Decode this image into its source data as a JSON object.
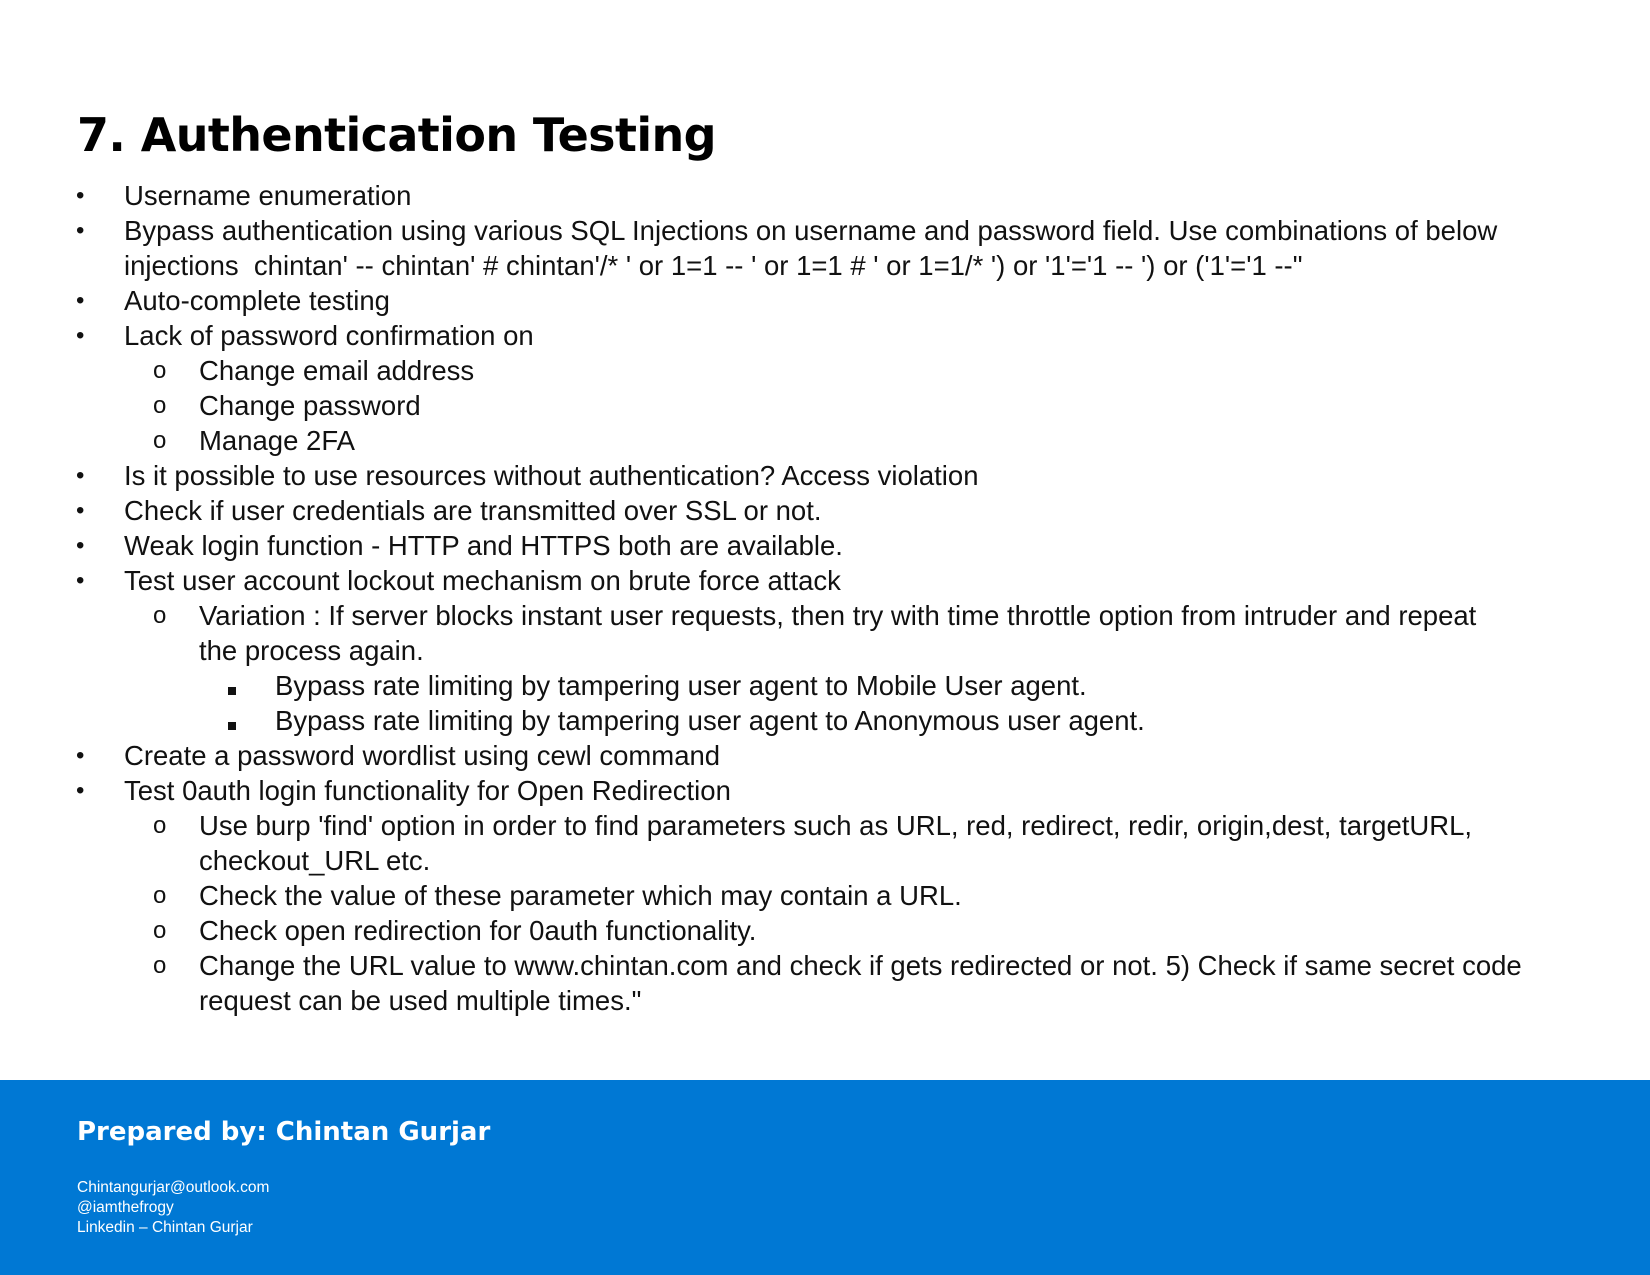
{
  "page": {
    "title": "7. Authentication Testing",
    "accent_color": "#0078d4"
  },
  "list": {
    "bullet_l1": "•",
    "bullet_l2": "o",
    "bullet_l3": "square-bullet-icon",
    "items": [
      {
        "level": 1,
        "lines": [
          "Username enumeration"
        ]
      },
      {
        "level": 1,
        "lines": [
          "Bypass authentication using various SQL Injections on username and password field. Use combinations of below",
          "injections  chintan' -- chintan' # chintan'/* ' or 1=1 -- ' or 1=1 # ' or 1=1/* ') or '1'='1 -- ') or ('1'='1 --\""
        ]
      },
      {
        "level": 1,
        "lines": [
          "Auto-complete testing"
        ]
      },
      {
        "level": 1,
        "lines": [
          "Lack of password confirmation on"
        ]
      },
      {
        "level": 2,
        "lines": [
          "Change email address"
        ]
      },
      {
        "level": 2,
        "lines": [
          "Change password"
        ]
      },
      {
        "level": 2,
        "lines": [
          "Manage 2FA"
        ]
      },
      {
        "level": 1,
        "lines": [
          "Is it possible to use resources without authentication? Access violation"
        ]
      },
      {
        "level": 1,
        "lines": [
          "Check if user credentials are transmitted over SSL or not."
        ]
      },
      {
        "level": 1,
        "lines": [
          "Weak login function - HTTP and HTTPS both are available."
        ]
      },
      {
        "level": 1,
        "lines": [
          "Test user account lockout mechanism on brute force attack"
        ]
      },
      {
        "level": 2,
        "lines": [
          "Variation : If server blocks instant user requests, then try with time throttle option from intruder and repeat",
          "the process again."
        ]
      },
      {
        "level": 3,
        "lines": [
          "Bypass rate limiting by tampering user agent to Mobile User agent."
        ]
      },
      {
        "level": 3,
        "lines": [
          "Bypass rate limiting by tampering user agent to Anonymous user agent."
        ]
      },
      {
        "level": 1,
        "lines": [
          "Create a password wordlist using cewl command"
        ]
      },
      {
        "level": 1,
        "lines": [
          "Test 0auth login functionality for Open Redirection"
        ]
      },
      {
        "level": 2,
        "lines": [
          "Use burp 'find' option in order to find parameters such as URL, red, redirect, redir, origin,dest, targetURL,",
          "checkout_URL etc."
        ]
      },
      {
        "level": 2,
        "lines": [
          "Check the value of these parameter which may contain a URL."
        ]
      },
      {
        "level": 2,
        "lines": [
          "Check open redirection for 0auth functionality."
        ]
      },
      {
        "level": 2,
        "lines": [
          "Change the URL value to www.chintan.com and check if gets redirected or not. 5) Check if same secret code",
          "request can be used multiple times.\""
        ]
      }
    ]
  },
  "footer": {
    "title": "Prepared by: Chintan Gurjar",
    "email": "Chintangurjar@outlook.com",
    "handle": "@iamthefrogy",
    "linkedin": "Linkedin – Chintan Gurjar"
  }
}
